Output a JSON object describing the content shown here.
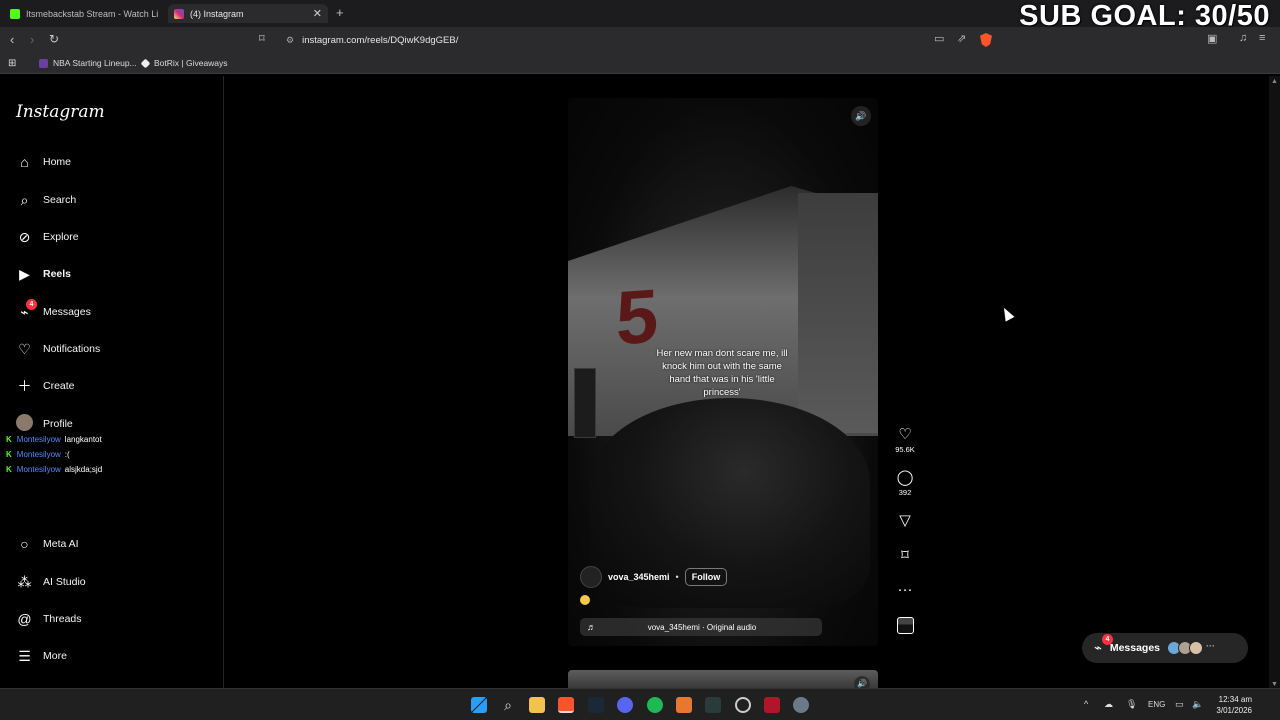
{
  "overlay": {
    "sub_goal": "SUB GOAL: 30/50"
  },
  "browser": {
    "tabs": [
      {
        "label": "Itsmebackstab Stream - Watch Live o..."
      },
      {
        "label": "(4) Instagram"
      }
    ],
    "url": "instagram.com/reels/DQiwK9dgGEB/",
    "bookmarks": [
      {
        "label": "NBA Starting Lineup..."
      },
      {
        "label": "BotRix | Giveaways"
      }
    ]
  },
  "sidebar": {
    "logo": "Instagram",
    "items": [
      {
        "label": "Home",
        "icon": "home-icon"
      },
      {
        "label": "Search",
        "icon": "search-icon"
      },
      {
        "label": "Explore",
        "icon": "compass-icon"
      },
      {
        "label": "Reels",
        "icon": "reels-icon"
      },
      {
        "label": "Messages",
        "icon": "messenger-icon",
        "badge": "4"
      },
      {
        "label": "Notifications",
        "icon": "heart-icon"
      },
      {
        "label": "Create",
        "icon": "plus-icon"
      },
      {
        "label": "Profile",
        "icon": "avatar"
      }
    ],
    "bottom_items": [
      {
        "label": "Meta AI",
        "icon": "meta-ai-icon"
      },
      {
        "label": "AI Studio",
        "icon": "ai-studio-icon"
      },
      {
        "label": "Threads",
        "icon": "threads-icon"
      },
      {
        "label": "More",
        "icon": "menu-icon"
      }
    ]
  },
  "stream_chat": [
    {
      "user": "Montesilyow",
      "message": "langkantot"
    },
    {
      "user": "Montesilyow",
      "message": ":("
    },
    {
      "user": "Montesilyow",
      "message": "alsjkda;sjd"
    }
  ],
  "reel": {
    "caption": "Her new man dont scare me, ill knock him out with the same hand that was in his 'little princess'",
    "username": "vova_345hemi",
    "separator": "•",
    "follow_label": "Follow",
    "audio": "vova_345hemi · Original audio",
    "likes": "95.6K",
    "comments": "392"
  },
  "messages_pill": {
    "label": "Messages",
    "badge": "4"
  },
  "taskbar": {
    "lang": "ENG",
    "time": "12:34 am",
    "date": "3/01/2026"
  },
  "colors": {
    "kick_green": "#53fc18",
    "chat_user_blue": "#4d8dff",
    "notification_red": "#ff3040",
    "brave_orange": "#fb542b"
  }
}
